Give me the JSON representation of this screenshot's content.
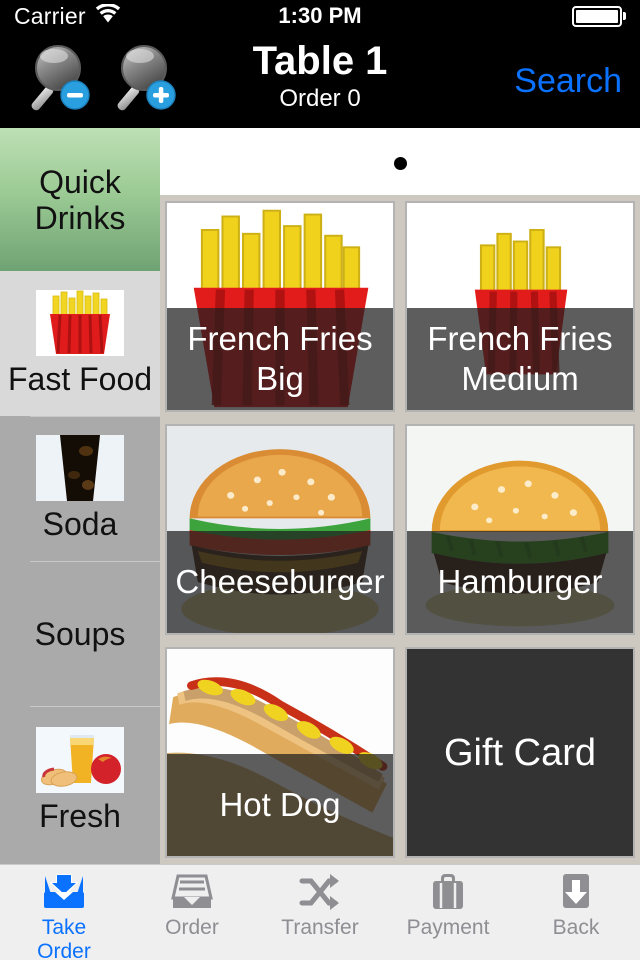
{
  "status_bar": {
    "carrier": "Carrier",
    "wifi_icon": "wifi-icon",
    "time": "1:30 PM",
    "battery_icon": "battery-full-icon"
  },
  "nav_bar": {
    "title": "Table 1",
    "subtitle": "Order 0",
    "search_label": "Search",
    "zoom_out_icon": "magnifier-minus-icon",
    "zoom_in_icon": "magnifier-plus-icon",
    "accent_color": "#0a72ff"
  },
  "sidebar": {
    "categories": [
      {
        "label": "Quick\nDrinks",
        "thumb": null,
        "selected": false,
        "highlight_color": "#9ccb95"
      },
      {
        "label": "Fast Food",
        "thumb": "fries-thumb",
        "selected": true,
        "highlight_color": "#d9d9d9"
      },
      {
        "label": "Soda",
        "thumb": "soda-thumb",
        "selected": false,
        "highlight_color": "#aaaaaa"
      },
      {
        "label": "Soups",
        "thumb": null,
        "selected": false,
        "highlight_color": "#aaaaaa"
      },
      {
        "label": "Fresh",
        "thumb": "juice-thumb",
        "selected": false,
        "highlight_color": "#aaaaaa"
      }
    ]
  },
  "grid": {
    "page_dots": 1,
    "current_page": 0,
    "items": [
      {
        "name": "French Fries\nBig",
        "image": "fries-big-image",
        "style": "image"
      },
      {
        "name": "French Fries\nMedium",
        "image": "fries-medium-image",
        "style": "image"
      },
      {
        "name": "Cheeseburger",
        "image": "cheeseburger-image",
        "style": "image"
      },
      {
        "name": "Hamburger",
        "image": "hamburger-image",
        "style": "image"
      },
      {
        "name": "Hot Dog",
        "image": "hotdog-image",
        "style": "image"
      },
      {
        "name": "Gift Card",
        "image": null,
        "style": "plain"
      }
    ]
  },
  "toolbar": {
    "tabs": [
      {
        "label": "Take\nOrder",
        "icon": "inbox-down-icon",
        "active": true
      },
      {
        "label": "Order",
        "icon": "tray-stack-icon",
        "active": false
      },
      {
        "label": "Transfer",
        "icon": "shuffle-icon",
        "active": false
      },
      {
        "label": "Payment",
        "icon": "briefcase-icon",
        "active": false
      },
      {
        "label": "Back",
        "icon": "arrow-down-square-icon",
        "active": false
      }
    ]
  }
}
